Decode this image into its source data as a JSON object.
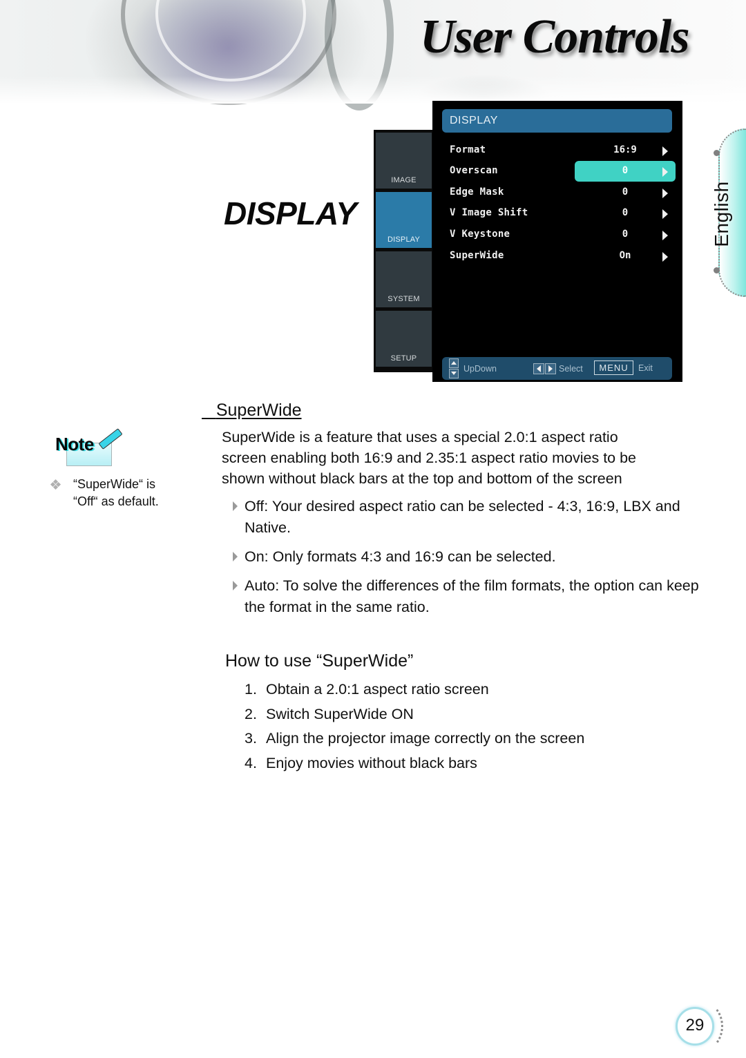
{
  "header": {
    "title": "User Controls"
  },
  "language_tab": {
    "label": "English"
  },
  "section": {
    "heading": "DISPLAY"
  },
  "osd": {
    "tabs": [
      {
        "label": "IMAGE",
        "active": false
      },
      {
        "label": "DISPLAY",
        "active": true
      },
      {
        "label": "SYSTEM",
        "active": false
      },
      {
        "label": "SETUP",
        "active": false
      }
    ],
    "panel_title": "DISPLAY",
    "rows": [
      {
        "label": "Format",
        "value": "16:9"
      },
      {
        "label": "Overscan",
        "value": "0",
        "selected": true
      },
      {
        "label": "Edge Mask",
        "value": "0"
      },
      {
        "label": "V Image Shift",
        "value": "0"
      },
      {
        "label": "V Keystone",
        "value": "0"
      },
      {
        "label": "SuperWide",
        "value": "On"
      }
    ],
    "footer": {
      "updown": "UpDown",
      "select": "Select",
      "menu_key": "MENU",
      "exit": "Exit"
    },
    "colors": {
      "active_tab": "#2b7ba8",
      "header_bar": "#2a6d99",
      "highlight": "#40d2c4",
      "footer_bar": "#1f4c6a"
    }
  },
  "note": {
    "badge": "Note",
    "text_line1": "“SuperWide“ is",
    "text_line2": "“Off“ as default."
  },
  "content": {
    "subheading": "SuperWide",
    "intro_lines": [
      "SuperWide is a feature that uses a special 2.0:1 aspect ratio",
      "screen enabling both 16:9 and 2.35:1 aspect ratio movies to be",
      "shown without black bars at the top and bottom of the screen"
    ],
    "bullets": [
      "Off: Your desired aspect ratio can be selected - 4:3, 16:9, LBX and Native.",
      "On: Only formats 4:3 and 16:9 can be selected.",
      "Auto: To solve the differences of the film formats, the option can keep the format in the same ratio."
    ],
    "howto_heading": "How to use “SuperWide”",
    "steps": [
      {
        "num": "1.",
        "text": "Obtain a 2.0:1 aspect ratio screen"
      },
      {
        "num": "2.",
        "text": "Switch SuperWide ON"
      },
      {
        "num": "3.",
        "text": "Align the projector image correctly on the screen"
      },
      {
        "num": "4.",
        "text": "Enjoy movies without black bars"
      }
    ]
  },
  "footer": {
    "page_number": "29"
  }
}
